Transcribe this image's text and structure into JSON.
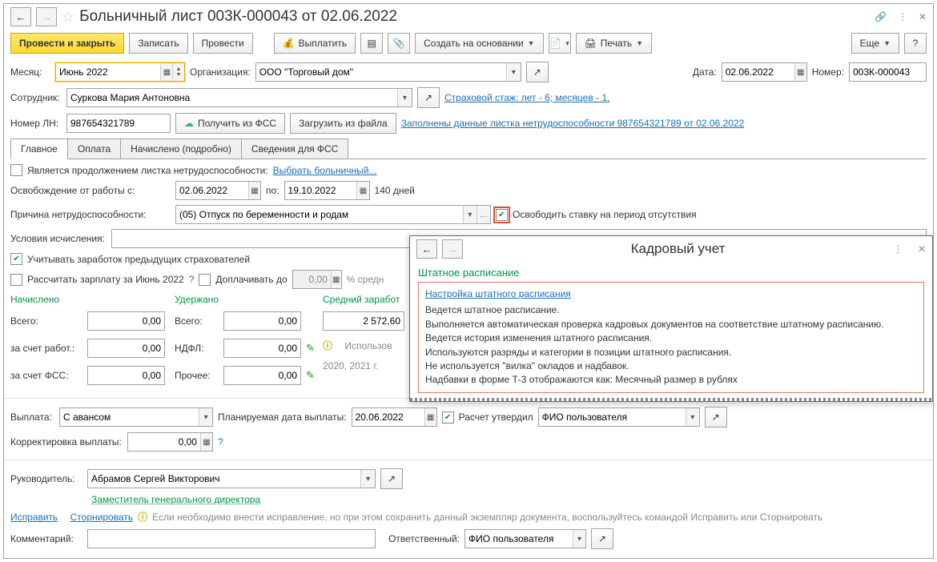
{
  "header": {
    "title": "Больничный лист 003К-000043 от 02.06.2022"
  },
  "toolbar": {
    "post_close": "Провести и закрыть",
    "write": "Записать",
    "post": "Провести",
    "pay": "Выплатить",
    "create_based": "Создать на основании",
    "print": "Печать",
    "more": "Еще"
  },
  "form": {
    "month_lbl": "Месяц:",
    "month": "Июнь 2022",
    "org_lbl": "Организация:",
    "org": "ООО \"Торговый дом\"",
    "date_lbl": "Дата:",
    "date": "02.06.2022",
    "number_lbl": "Номер:",
    "number": "003К-000043",
    "employee_lbl": "Сотрудник:",
    "employee": "Суркова Мария Антоновна",
    "stazh_link": "Страховой стаж: лет - 6; месяцев - 1.",
    "ln_lbl": "Номер ЛН:",
    "ln": "987654321789",
    "get_fss": "Получить из ФСС",
    "load_file": "Загрузить из файла",
    "ln_link": "Заполнены данные листка нетрудоспособности 987654321789 от 02.06.2022"
  },
  "tabs": [
    "Главное",
    "Оплата",
    "Начислено (подробно)",
    "Сведения для ФСС"
  ],
  "main": {
    "continuation_lbl": "Является продолжением листка нетрудоспособности:",
    "select_sick": "Выбрать больничный...",
    "release_lbl": "Освобождение от работы с:",
    "date_from": "02.06.2022",
    "to_lbl": "по:",
    "date_to": "19.10.2022",
    "days": "140 дней",
    "reason_lbl": "Причина нетрудоспособности:",
    "reason": "(05) Отпуск по беременности и родам",
    "free_rate": "Освободить ставку на период отсутствия",
    "conditions_lbl": "Условия исчисления:",
    "prev_earnings": "Учитывать заработок предыдущих страхователей",
    "calc_salary": "Рассчитать зарплату за Июнь 2022",
    "extra_pay": "Доплачивать до",
    "extra_val": "0,00",
    "percent_suffix": "% средн",
    "accrued_h": "Начислено",
    "withheld_h": "Удержано",
    "avg_h": "Средний заработ",
    "total_lbl": "Всего:",
    "employer_lbl": "за счет работ.:",
    "fss_lbl": "за счет ФСС:",
    "ndfl_lbl": "НДФЛ:",
    "other_lbl": "Прочее:",
    "vals": {
      "acc_total": "0,00",
      "acc_emp": "0,00",
      "acc_fss": "0,00",
      "wth_total": "0,00",
      "wth_ndfl": "0,00",
      "wth_other": "0,00",
      "avg": "2 572,60"
    },
    "used_hint1": "Использов",
    "used_hint2": "2020, 2021 г.",
    "payout_lbl": "Выплата:",
    "payout": "С авансом",
    "plan_date_lbl": "Планируемая дата выплаты:",
    "plan_date": "20.06.2022",
    "approved_lbl": "Расчет утвердил",
    "approver": "ФИО пользователя",
    "corr_lbl": "Корректировка выплаты:",
    "corr_val": "0,00"
  },
  "footer": {
    "head_lbl": "Руководитель:",
    "head": "Абрамов Сергей Викторович",
    "position": "Заместитель генерального директора",
    "fix": "Исправить",
    "revert": "Сторнировать",
    "fix_hint": "Если необходимо внести исправление, но при этом сохранить данный экземпляр документа, воспользуйтесь командой Исправить или Сторнировать",
    "comment_lbl": "Комментарий:",
    "resp_lbl": "Ответственный:",
    "resp": "ФИО пользователя"
  },
  "popup": {
    "title": "Кадровый учет",
    "section": "Штатное расписание",
    "link": "Настройка штатного расписания",
    "lines": [
      "Ведется штатное расписание.",
      "Выполняется автоматическая проверка кадровых документов на соответствие штатному расписанию.",
      "Ведется история изменения штатного расписания.",
      "Используются разряды и категории в позиции штатного расписания.",
      "Не используется \"вилка\" окладов и надбавок.",
      "Надбавки в форме Т-3 отображаются как: Месячный размер в рублях"
    ]
  }
}
